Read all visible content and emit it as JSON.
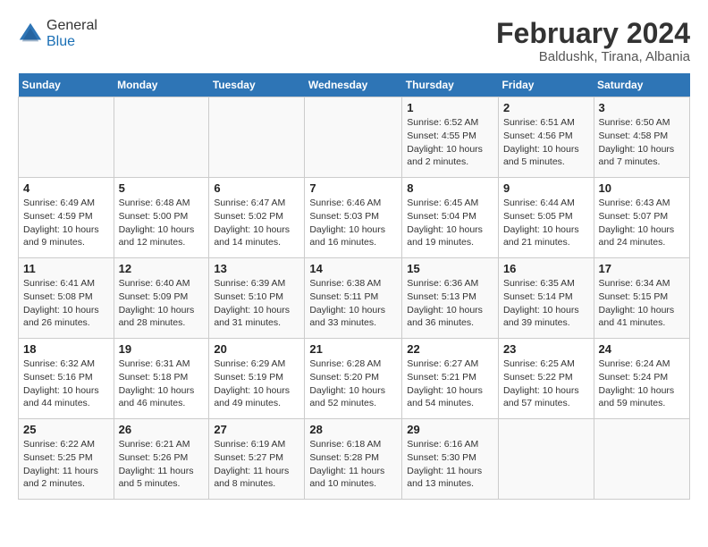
{
  "header": {
    "logo_general": "General",
    "logo_blue": "Blue",
    "month_title": "February 2024",
    "subtitle": "Baldushk, Tirana, Albania"
  },
  "days_of_week": [
    "Sunday",
    "Monday",
    "Tuesday",
    "Wednesday",
    "Thursday",
    "Friday",
    "Saturday"
  ],
  "weeks": [
    [
      {
        "num": "",
        "detail": ""
      },
      {
        "num": "",
        "detail": ""
      },
      {
        "num": "",
        "detail": ""
      },
      {
        "num": "",
        "detail": ""
      },
      {
        "num": "1",
        "detail": "Sunrise: 6:52 AM\nSunset: 4:55 PM\nDaylight: 10 hours\nand 2 minutes."
      },
      {
        "num": "2",
        "detail": "Sunrise: 6:51 AM\nSunset: 4:56 PM\nDaylight: 10 hours\nand 5 minutes."
      },
      {
        "num": "3",
        "detail": "Sunrise: 6:50 AM\nSunset: 4:58 PM\nDaylight: 10 hours\nand 7 minutes."
      }
    ],
    [
      {
        "num": "4",
        "detail": "Sunrise: 6:49 AM\nSunset: 4:59 PM\nDaylight: 10 hours\nand 9 minutes."
      },
      {
        "num": "5",
        "detail": "Sunrise: 6:48 AM\nSunset: 5:00 PM\nDaylight: 10 hours\nand 12 minutes."
      },
      {
        "num": "6",
        "detail": "Sunrise: 6:47 AM\nSunset: 5:02 PM\nDaylight: 10 hours\nand 14 minutes."
      },
      {
        "num": "7",
        "detail": "Sunrise: 6:46 AM\nSunset: 5:03 PM\nDaylight: 10 hours\nand 16 minutes."
      },
      {
        "num": "8",
        "detail": "Sunrise: 6:45 AM\nSunset: 5:04 PM\nDaylight: 10 hours\nand 19 minutes."
      },
      {
        "num": "9",
        "detail": "Sunrise: 6:44 AM\nSunset: 5:05 PM\nDaylight: 10 hours\nand 21 minutes."
      },
      {
        "num": "10",
        "detail": "Sunrise: 6:43 AM\nSunset: 5:07 PM\nDaylight: 10 hours\nand 24 minutes."
      }
    ],
    [
      {
        "num": "11",
        "detail": "Sunrise: 6:41 AM\nSunset: 5:08 PM\nDaylight: 10 hours\nand 26 minutes."
      },
      {
        "num": "12",
        "detail": "Sunrise: 6:40 AM\nSunset: 5:09 PM\nDaylight: 10 hours\nand 28 minutes."
      },
      {
        "num": "13",
        "detail": "Sunrise: 6:39 AM\nSunset: 5:10 PM\nDaylight: 10 hours\nand 31 minutes."
      },
      {
        "num": "14",
        "detail": "Sunrise: 6:38 AM\nSunset: 5:11 PM\nDaylight: 10 hours\nand 33 minutes."
      },
      {
        "num": "15",
        "detail": "Sunrise: 6:36 AM\nSunset: 5:13 PM\nDaylight: 10 hours\nand 36 minutes."
      },
      {
        "num": "16",
        "detail": "Sunrise: 6:35 AM\nSunset: 5:14 PM\nDaylight: 10 hours\nand 39 minutes."
      },
      {
        "num": "17",
        "detail": "Sunrise: 6:34 AM\nSunset: 5:15 PM\nDaylight: 10 hours\nand 41 minutes."
      }
    ],
    [
      {
        "num": "18",
        "detail": "Sunrise: 6:32 AM\nSunset: 5:16 PM\nDaylight: 10 hours\nand 44 minutes."
      },
      {
        "num": "19",
        "detail": "Sunrise: 6:31 AM\nSunset: 5:18 PM\nDaylight: 10 hours\nand 46 minutes."
      },
      {
        "num": "20",
        "detail": "Sunrise: 6:29 AM\nSunset: 5:19 PM\nDaylight: 10 hours\nand 49 minutes."
      },
      {
        "num": "21",
        "detail": "Sunrise: 6:28 AM\nSunset: 5:20 PM\nDaylight: 10 hours\nand 52 minutes."
      },
      {
        "num": "22",
        "detail": "Sunrise: 6:27 AM\nSunset: 5:21 PM\nDaylight: 10 hours\nand 54 minutes."
      },
      {
        "num": "23",
        "detail": "Sunrise: 6:25 AM\nSunset: 5:22 PM\nDaylight: 10 hours\nand 57 minutes."
      },
      {
        "num": "24",
        "detail": "Sunrise: 6:24 AM\nSunset: 5:24 PM\nDaylight: 10 hours\nand 59 minutes."
      }
    ],
    [
      {
        "num": "25",
        "detail": "Sunrise: 6:22 AM\nSunset: 5:25 PM\nDaylight: 11 hours\nand 2 minutes."
      },
      {
        "num": "26",
        "detail": "Sunrise: 6:21 AM\nSunset: 5:26 PM\nDaylight: 11 hours\nand 5 minutes."
      },
      {
        "num": "27",
        "detail": "Sunrise: 6:19 AM\nSunset: 5:27 PM\nDaylight: 11 hours\nand 8 minutes."
      },
      {
        "num": "28",
        "detail": "Sunrise: 6:18 AM\nSunset: 5:28 PM\nDaylight: 11 hours\nand 10 minutes."
      },
      {
        "num": "29",
        "detail": "Sunrise: 6:16 AM\nSunset: 5:30 PM\nDaylight: 11 hours\nand 13 minutes."
      },
      {
        "num": "",
        "detail": ""
      },
      {
        "num": "",
        "detail": ""
      }
    ]
  ]
}
